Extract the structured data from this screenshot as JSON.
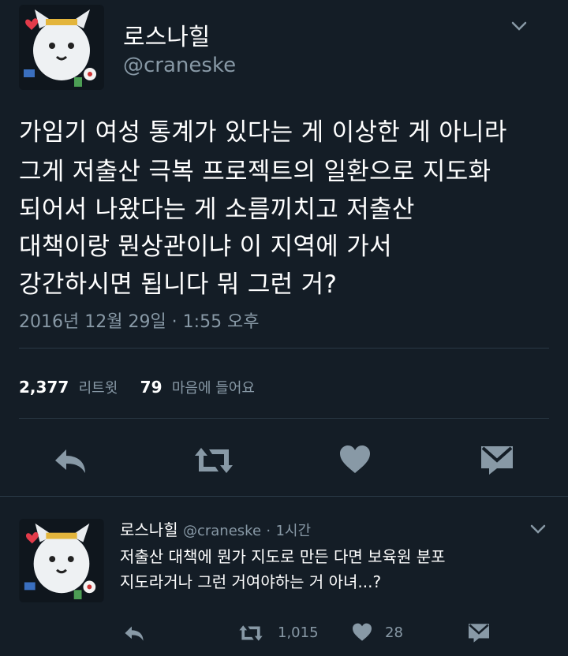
{
  "tweet": {
    "name": "로스나힐",
    "handle": "@craneske",
    "body_lines": [
      "가임기 여성 통계가 있다는 게 이상한 게 아니라",
      "그게 저출산 극복 프로젝트의 일환으로 지도화",
      "되어서 나왔다는 게 소름끼치고 저출산",
      "대책이랑 뭔상관이냐 이 지역에 가서",
      "강간하시면 됩니다 뭐 그런 거?"
    ],
    "timestamp": "2016년 12월 29일 · 1:55 오후",
    "retweet_count": "2,377",
    "retweet_label": "리트윗",
    "like_count": "79",
    "like_label": "마음에 들어요",
    "icons": [
      "reply-icon",
      "retweet-icon",
      "heart-icon",
      "direct-message-icon",
      "chevron-down-icon"
    ]
  },
  "reply": {
    "name": "로스나힐",
    "handle": "@craneske",
    "separator": "·",
    "time": "1시간",
    "lines": [
      "저출산 대책에 뭔가 지도로 만든 다면 보육원 분포",
      "지도라거나 그런 거여야하는 거 아녀...?"
    ],
    "retweet_count": "1,015",
    "like_count": "28"
  },
  "colors": {
    "background": "#141d26",
    "text_primary": "#ffffff",
    "text_secondary": "#8899a6",
    "divider": "#2a3945"
  }
}
